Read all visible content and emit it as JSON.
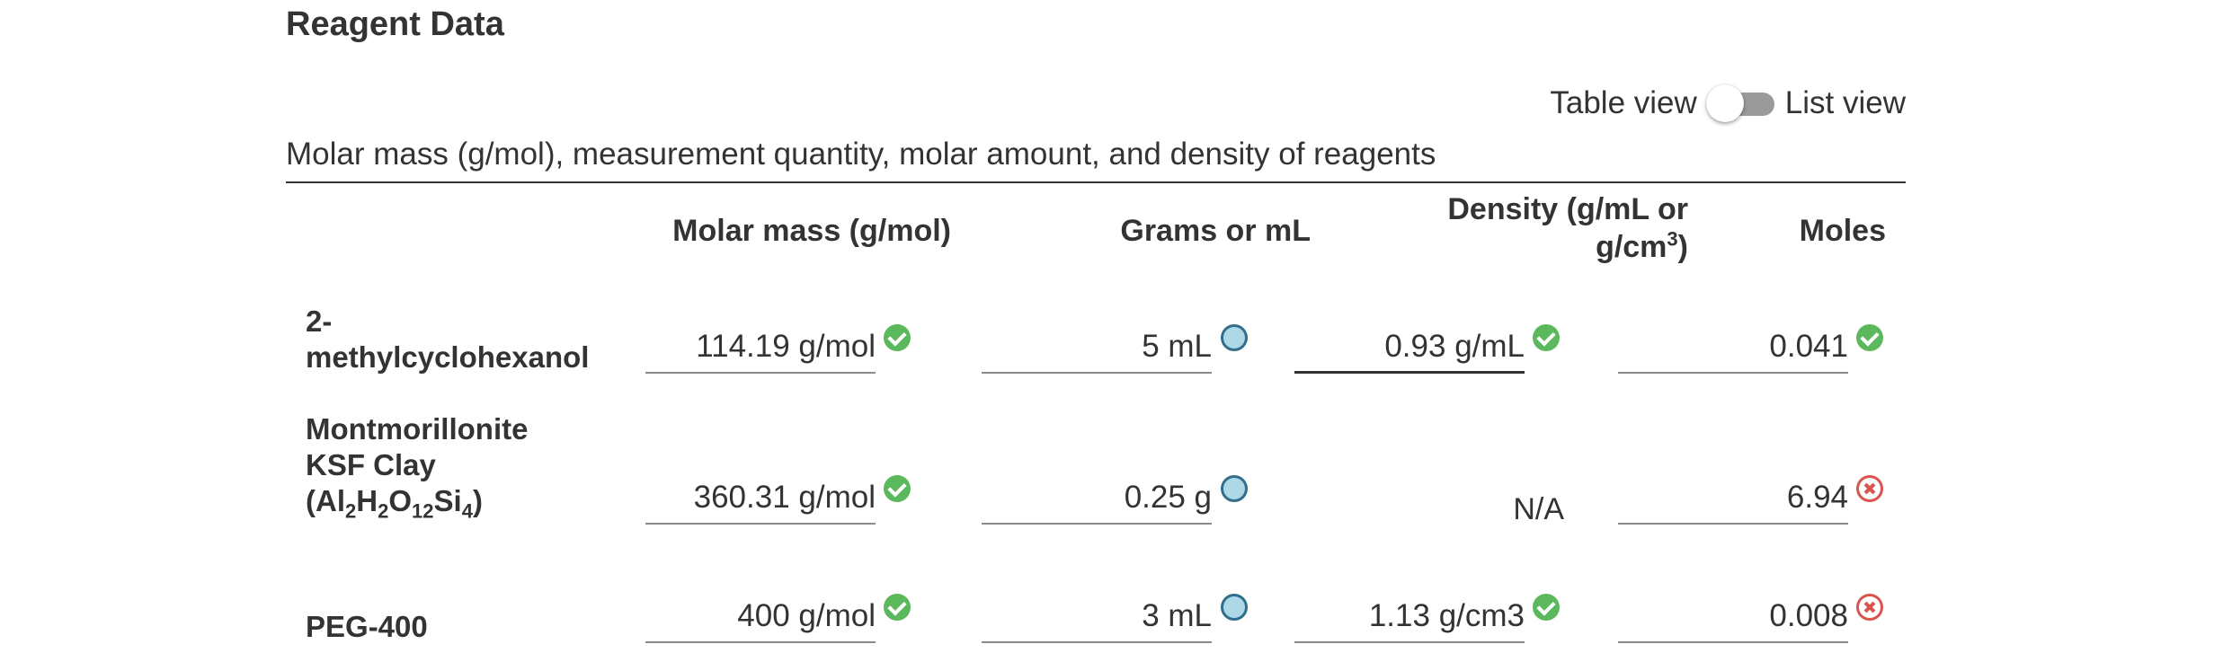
{
  "section": {
    "title": "Reagent Data"
  },
  "view_toggle": {
    "left_label": "Table view",
    "right_label": "List view",
    "state": "off"
  },
  "table": {
    "caption": "Molar mass (g/mol), measurement quantity, molar amount, and density of reagents",
    "headers": {
      "molar_mass": "Molar mass (g/mol)",
      "grams_ml": "Grams or mL",
      "density_line1": "Density (g/mL or",
      "density_line2_pre": "g/cm",
      "density_line2_sup": "3",
      "density_line2_post": ")",
      "moles": "Moles"
    },
    "rows": [
      {
        "label_line1": "2-",
        "label_line2": "methylcyclohexanol",
        "molar_mass": "114.19 g/mol",
        "molar_mass_status": "correct",
        "quantity": "5 mL",
        "quantity_status": "info",
        "density": "0.93 g/mL",
        "density_status": "correct",
        "moles": "0.041",
        "moles_status": "correct"
      },
      {
        "label_line1": "Montmorillonite",
        "label_line2": "KSF Clay",
        "label_formula": {
          "open": "(Al",
          "al_sub": "2",
          "h": "H",
          "h_sub": "2",
          "o": "O",
          "o_sub": "12",
          "si": "Si",
          "si_sub": "4",
          "close": ")"
        },
        "molar_mass": "360.31 g/mol",
        "molar_mass_status": "correct",
        "quantity": "0.25 g",
        "quantity_status": "info",
        "density": "N/A",
        "moles": "6.94",
        "moles_status": "incorrect"
      },
      {
        "label_line1": "PEG-400",
        "molar_mass": "400 g/mol",
        "molar_mass_status": "correct",
        "quantity": "3 mL",
        "quantity_status": "info",
        "density": "1.13 g/cm3",
        "density_status": "correct",
        "moles": "0.008",
        "moles_status": "incorrect"
      }
    ]
  },
  "colors": {
    "text": "#333333",
    "correct": "#5cb85c",
    "info_fill": "#add8e6",
    "info_border": "#2f6f8c",
    "incorrect": "#d9534f",
    "toggle_track": "#9a9a9a"
  }
}
